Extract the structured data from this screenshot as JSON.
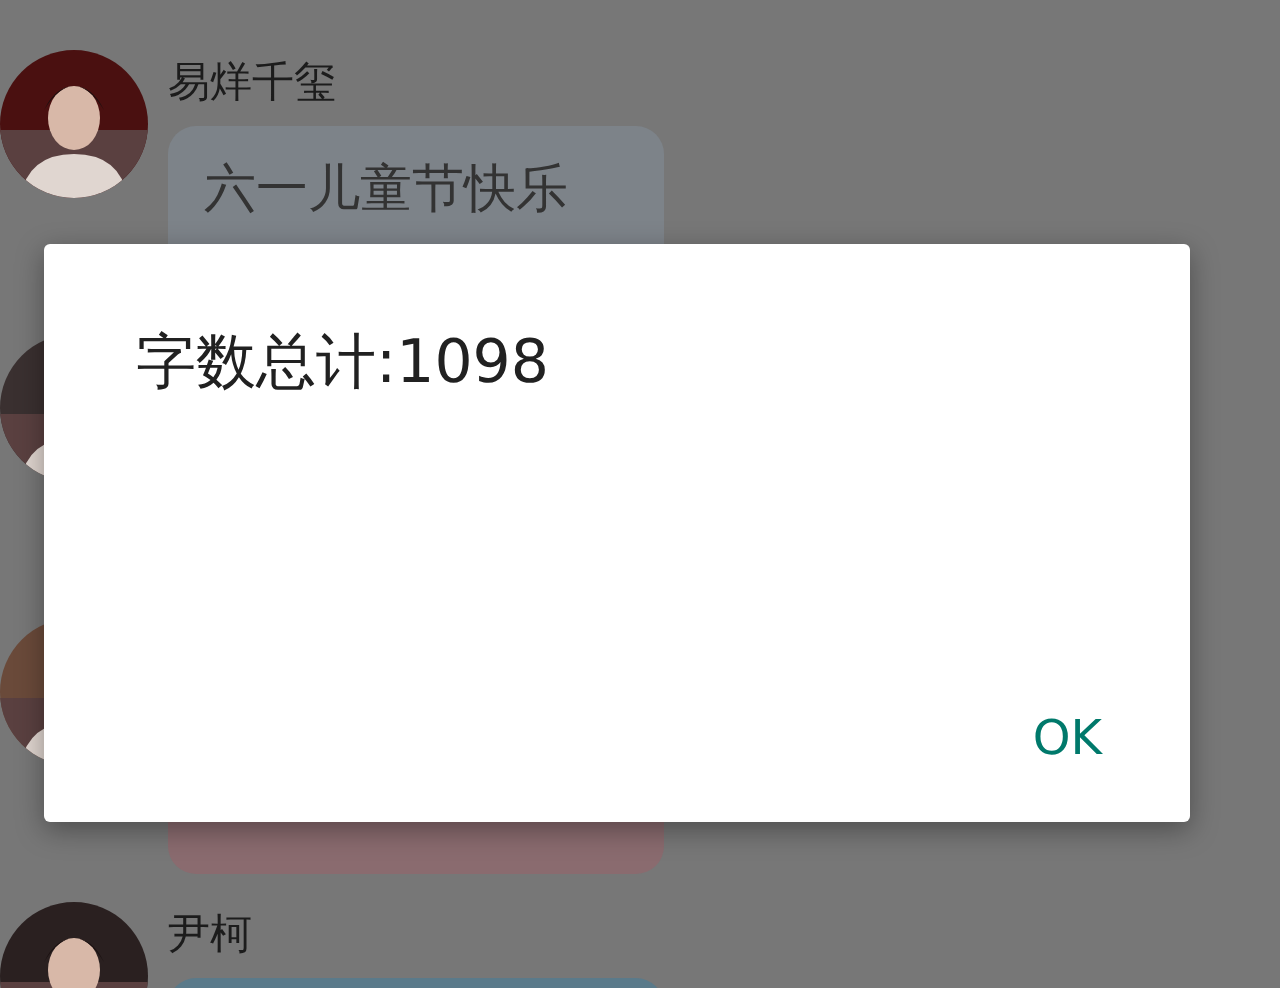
{
  "messages": [
    {
      "kind": "bubble",
      "name": "易烊千玺",
      "text": "六一儿童节快乐",
      "color": "#7d8389"
    },
    {
      "kind": "covered"
    },
    {
      "kind": "bubble",
      "color": "#8a6b6f"
    },
    {
      "kind": "bubble",
      "name": "尹柯",
      "color": "#5a7a8a"
    }
  ],
  "dialog": {
    "message": "字数总计:1098",
    "buttons": [
      "OK"
    ]
  }
}
